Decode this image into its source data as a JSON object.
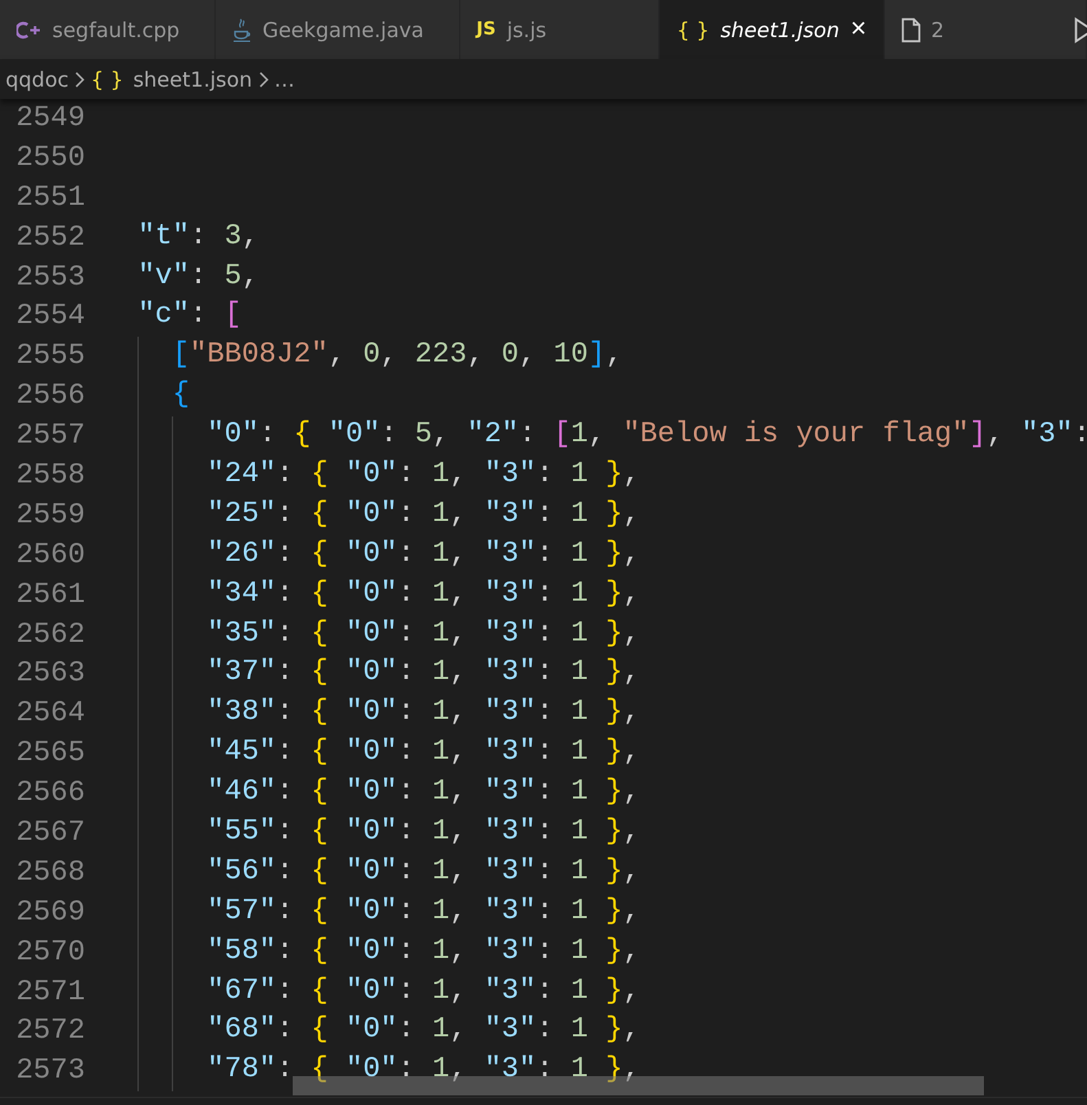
{
  "tabs": [
    {
      "kind": "cpp",
      "label": "segfault.cpp",
      "selected": false
    },
    {
      "kind": "java",
      "label": "Geekgame.java",
      "selected": false
    },
    {
      "kind": "js",
      "icon_text": "JS",
      "label": "js.js",
      "selected": false
    },
    {
      "kind": "json",
      "icon_text": "{ }",
      "label": "sheet1.json",
      "selected": true,
      "close": "×"
    },
    {
      "kind": "file",
      "label": "2",
      "selected": false
    }
  ],
  "breadcrumb": [
    {
      "text": "qqdoc"
    },
    {
      "icon_text": "{ }",
      "text": "sheet1.json"
    },
    {
      "text": "…"
    }
  ],
  "lines": [
    {
      "number": "2549"
    },
    {
      "number": "2550"
    },
    {
      "number": "2551"
    },
    {
      "number": "2552",
      "tokens": [
        {
          "kind": "key",
          "text": "  \"t\""
        },
        {
          "kind": "punct",
          "text": ": "
        },
        {
          "kind": "number",
          "text": "3"
        },
        {
          "kind": "punct",
          "text": ","
        }
      ]
    },
    {
      "number": "2553",
      "tokens": [
        {
          "kind": "key",
          "text": "  \"v\""
        },
        {
          "kind": "punct",
          "text": ": "
        },
        {
          "kind": "number",
          "text": "5"
        },
        {
          "kind": "punct",
          "text": ","
        }
      ]
    },
    {
      "number": "2554",
      "tokens": [
        {
          "kind": "key",
          "text": "  \"c\""
        },
        {
          "kind": "punct",
          "text": ": "
        },
        {
          "kind": "bracket-purple",
          "text": "["
        }
      ]
    },
    {
      "number": "2555",
      "tokens": [
        {
          "kind": "bracket-blue",
          "text": "    ["
        },
        {
          "kind": "string",
          "text": "\"BB08J2\""
        },
        {
          "kind": "punct",
          "text": ", "
        },
        {
          "kind": "number",
          "text": "0"
        },
        {
          "kind": "punct",
          "text": ", "
        },
        {
          "kind": "number",
          "text": "223"
        },
        {
          "kind": "punct",
          "text": ", "
        },
        {
          "kind": "number",
          "text": "0"
        },
        {
          "kind": "punct",
          "text": ", "
        },
        {
          "kind": "number",
          "text": "10"
        },
        {
          "kind": "bracket-blue",
          "text": "]"
        },
        {
          "kind": "punct",
          "text": ","
        }
      ]
    },
    {
      "number": "2556",
      "tokens": [
        {
          "kind": "bracket-blue",
          "text": "    {"
        }
      ]
    },
    {
      "number": "2557",
      "tokens": [
        {
          "kind": "key",
          "text": "      \"0\""
        },
        {
          "kind": "punct",
          "text": ": "
        },
        {
          "kind": "bracket-gold",
          "text": "{ "
        },
        {
          "kind": "key",
          "text": "\"0\""
        },
        {
          "kind": "punct",
          "text": ": "
        },
        {
          "kind": "number",
          "text": "5"
        },
        {
          "kind": "punct",
          "text": ", "
        },
        {
          "kind": "key",
          "text": "\"2\""
        },
        {
          "kind": "punct",
          "text": ": "
        },
        {
          "kind": "bracket-purple",
          "text": "["
        },
        {
          "kind": "number",
          "text": "1"
        },
        {
          "kind": "punct",
          "text": ", "
        },
        {
          "kind": "string",
          "text": "\"Below is your flag\""
        },
        {
          "kind": "bracket-purple",
          "text": "]"
        },
        {
          "kind": "punct",
          "text": ", "
        },
        {
          "kind": "key",
          "text": "\"3\""
        },
        {
          "kind": "punct",
          "text": ":"
        }
      ]
    },
    {
      "number": "2558",
      "tokens": [
        {
          "kind": "key",
          "text": "      \"24\""
        },
        {
          "kind": "punct",
          "text": ": "
        },
        {
          "kind": "bracket-gold",
          "text": "{ "
        },
        {
          "kind": "key",
          "text": "\"0\""
        },
        {
          "kind": "punct",
          "text": ": "
        },
        {
          "kind": "number",
          "text": "1"
        },
        {
          "kind": "punct",
          "text": ", "
        },
        {
          "kind": "key",
          "text": "\"3\""
        },
        {
          "kind": "punct",
          "text": ": "
        },
        {
          "kind": "number",
          "text": "1 "
        },
        {
          "kind": "bracket-gold",
          "text": "}"
        },
        {
          "kind": "punct",
          "text": ","
        }
      ]
    },
    {
      "number": "2559",
      "tokens": [
        {
          "kind": "key",
          "text": "      \"25\""
        },
        {
          "kind": "punct",
          "text": ": "
        },
        {
          "kind": "bracket-gold",
          "text": "{ "
        },
        {
          "kind": "key",
          "text": "\"0\""
        },
        {
          "kind": "punct",
          "text": ": "
        },
        {
          "kind": "number",
          "text": "1"
        },
        {
          "kind": "punct",
          "text": ", "
        },
        {
          "kind": "key",
          "text": "\"3\""
        },
        {
          "kind": "punct",
          "text": ": "
        },
        {
          "kind": "number",
          "text": "1 "
        },
        {
          "kind": "bracket-gold",
          "text": "}"
        },
        {
          "kind": "punct",
          "text": ","
        }
      ]
    },
    {
      "number": "2560",
      "tokens": [
        {
          "kind": "key",
          "text": "      \"26\""
        },
        {
          "kind": "punct",
          "text": ": "
        },
        {
          "kind": "bracket-gold",
          "text": "{ "
        },
        {
          "kind": "key",
          "text": "\"0\""
        },
        {
          "kind": "punct",
          "text": ": "
        },
        {
          "kind": "number",
          "text": "1"
        },
        {
          "kind": "punct",
          "text": ", "
        },
        {
          "kind": "key",
          "text": "\"3\""
        },
        {
          "kind": "punct",
          "text": ": "
        },
        {
          "kind": "number",
          "text": "1 "
        },
        {
          "kind": "bracket-gold",
          "text": "}"
        },
        {
          "kind": "punct",
          "text": ","
        }
      ]
    },
    {
      "number": "2561",
      "tokens": [
        {
          "kind": "key",
          "text": "      \"34\""
        },
        {
          "kind": "punct",
          "text": ": "
        },
        {
          "kind": "bracket-gold",
          "text": "{ "
        },
        {
          "kind": "key",
          "text": "\"0\""
        },
        {
          "kind": "punct",
          "text": ": "
        },
        {
          "kind": "number",
          "text": "1"
        },
        {
          "kind": "punct",
          "text": ", "
        },
        {
          "kind": "key",
          "text": "\"3\""
        },
        {
          "kind": "punct",
          "text": ": "
        },
        {
          "kind": "number",
          "text": "1 "
        },
        {
          "kind": "bracket-gold",
          "text": "}"
        },
        {
          "kind": "punct",
          "text": ","
        }
      ]
    },
    {
      "number": "2562",
      "tokens": [
        {
          "kind": "key",
          "text": "      \"35\""
        },
        {
          "kind": "punct",
          "text": ": "
        },
        {
          "kind": "bracket-gold",
          "text": "{ "
        },
        {
          "kind": "key",
          "text": "\"0\""
        },
        {
          "kind": "punct",
          "text": ": "
        },
        {
          "kind": "number",
          "text": "1"
        },
        {
          "kind": "punct",
          "text": ", "
        },
        {
          "kind": "key",
          "text": "\"3\""
        },
        {
          "kind": "punct",
          "text": ": "
        },
        {
          "kind": "number",
          "text": "1 "
        },
        {
          "kind": "bracket-gold",
          "text": "}"
        },
        {
          "kind": "punct",
          "text": ","
        }
      ]
    },
    {
      "number": "2563",
      "tokens": [
        {
          "kind": "key",
          "text": "      \"37\""
        },
        {
          "kind": "punct",
          "text": ": "
        },
        {
          "kind": "bracket-gold",
          "text": "{ "
        },
        {
          "kind": "key",
          "text": "\"0\""
        },
        {
          "kind": "punct",
          "text": ": "
        },
        {
          "kind": "number",
          "text": "1"
        },
        {
          "kind": "punct",
          "text": ", "
        },
        {
          "kind": "key",
          "text": "\"3\""
        },
        {
          "kind": "punct",
          "text": ": "
        },
        {
          "kind": "number",
          "text": "1 "
        },
        {
          "kind": "bracket-gold",
          "text": "}"
        },
        {
          "kind": "punct",
          "text": ","
        }
      ]
    },
    {
      "number": "2564",
      "tokens": [
        {
          "kind": "key",
          "text": "      \"38\""
        },
        {
          "kind": "punct",
          "text": ": "
        },
        {
          "kind": "bracket-gold",
          "text": "{ "
        },
        {
          "kind": "key",
          "text": "\"0\""
        },
        {
          "kind": "punct",
          "text": ": "
        },
        {
          "kind": "number",
          "text": "1"
        },
        {
          "kind": "punct",
          "text": ", "
        },
        {
          "kind": "key",
          "text": "\"3\""
        },
        {
          "kind": "punct",
          "text": ": "
        },
        {
          "kind": "number",
          "text": "1 "
        },
        {
          "kind": "bracket-gold",
          "text": "}"
        },
        {
          "kind": "punct",
          "text": ","
        }
      ]
    },
    {
      "number": "2565",
      "tokens": [
        {
          "kind": "key",
          "text": "      \"45\""
        },
        {
          "kind": "punct",
          "text": ": "
        },
        {
          "kind": "bracket-gold",
          "text": "{ "
        },
        {
          "kind": "key",
          "text": "\"0\""
        },
        {
          "kind": "punct",
          "text": ": "
        },
        {
          "kind": "number",
          "text": "1"
        },
        {
          "kind": "punct",
          "text": ", "
        },
        {
          "kind": "key",
          "text": "\"3\""
        },
        {
          "kind": "punct",
          "text": ": "
        },
        {
          "kind": "number",
          "text": "1 "
        },
        {
          "kind": "bracket-gold",
          "text": "}"
        },
        {
          "kind": "punct",
          "text": ","
        }
      ]
    },
    {
      "number": "2566",
      "tokens": [
        {
          "kind": "key",
          "text": "      \"46\""
        },
        {
          "kind": "punct",
          "text": ": "
        },
        {
          "kind": "bracket-gold",
          "text": "{ "
        },
        {
          "kind": "key",
          "text": "\"0\""
        },
        {
          "kind": "punct",
          "text": ": "
        },
        {
          "kind": "number",
          "text": "1"
        },
        {
          "kind": "punct",
          "text": ", "
        },
        {
          "kind": "key",
          "text": "\"3\""
        },
        {
          "kind": "punct",
          "text": ": "
        },
        {
          "kind": "number",
          "text": "1 "
        },
        {
          "kind": "bracket-gold",
          "text": "}"
        },
        {
          "kind": "punct",
          "text": ","
        }
      ]
    },
    {
      "number": "2567",
      "tokens": [
        {
          "kind": "key",
          "text": "      \"55\""
        },
        {
          "kind": "punct",
          "text": ": "
        },
        {
          "kind": "bracket-gold",
          "text": "{ "
        },
        {
          "kind": "key",
          "text": "\"0\""
        },
        {
          "kind": "punct",
          "text": ": "
        },
        {
          "kind": "number",
          "text": "1"
        },
        {
          "kind": "punct",
          "text": ", "
        },
        {
          "kind": "key",
          "text": "\"3\""
        },
        {
          "kind": "punct",
          "text": ": "
        },
        {
          "kind": "number",
          "text": "1 "
        },
        {
          "kind": "bracket-gold",
          "text": "}"
        },
        {
          "kind": "punct",
          "text": ","
        }
      ]
    },
    {
      "number": "2568",
      "tokens": [
        {
          "kind": "key",
          "text": "      \"56\""
        },
        {
          "kind": "punct",
          "text": ": "
        },
        {
          "kind": "bracket-gold",
          "text": "{ "
        },
        {
          "kind": "key",
          "text": "\"0\""
        },
        {
          "kind": "punct",
          "text": ": "
        },
        {
          "kind": "number",
          "text": "1"
        },
        {
          "kind": "punct",
          "text": ", "
        },
        {
          "kind": "key",
          "text": "\"3\""
        },
        {
          "kind": "punct",
          "text": ": "
        },
        {
          "kind": "number",
          "text": "1 "
        },
        {
          "kind": "bracket-gold",
          "text": "}"
        },
        {
          "kind": "punct",
          "text": ","
        }
      ]
    },
    {
      "number": "2569",
      "tokens": [
        {
          "kind": "key",
          "text": "      \"57\""
        },
        {
          "kind": "punct",
          "text": ": "
        },
        {
          "kind": "bracket-gold",
          "text": "{ "
        },
        {
          "kind": "key",
          "text": "\"0\""
        },
        {
          "kind": "punct",
          "text": ": "
        },
        {
          "kind": "number",
          "text": "1"
        },
        {
          "kind": "punct",
          "text": ", "
        },
        {
          "kind": "key",
          "text": "\"3\""
        },
        {
          "kind": "punct",
          "text": ": "
        },
        {
          "kind": "number",
          "text": "1 "
        },
        {
          "kind": "bracket-gold",
          "text": "}"
        },
        {
          "kind": "punct",
          "text": ","
        }
      ]
    },
    {
      "number": "2570",
      "tokens": [
        {
          "kind": "key",
          "text": "      \"58\""
        },
        {
          "kind": "punct",
          "text": ": "
        },
        {
          "kind": "bracket-gold",
          "text": "{ "
        },
        {
          "kind": "key",
          "text": "\"0\""
        },
        {
          "kind": "punct",
          "text": ": "
        },
        {
          "kind": "number",
          "text": "1"
        },
        {
          "kind": "punct",
          "text": ", "
        },
        {
          "kind": "key",
          "text": "\"3\""
        },
        {
          "kind": "punct",
          "text": ": "
        },
        {
          "kind": "number",
          "text": "1 "
        },
        {
          "kind": "bracket-gold",
          "text": "}"
        },
        {
          "kind": "punct",
          "text": ","
        }
      ]
    },
    {
      "number": "2571",
      "tokens": [
        {
          "kind": "key",
          "text": "      \"67\""
        },
        {
          "kind": "punct",
          "text": ": "
        },
        {
          "kind": "bracket-gold",
          "text": "{ "
        },
        {
          "kind": "key",
          "text": "\"0\""
        },
        {
          "kind": "punct",
          "text": ": "
        },
        {
          "kind": "number",
          "text": "1"
        },
        {
          "kind": "punct",
          "text": ", "
        },
        {
          "kind": "key",
          "text": "\"3\""
        },
        {
          "kind": "punct",
          "text": ": "
        },
        {
          "kind": "number",
          "text": "1 "
        },
        {
          "kind": "bracket-gold",
          "text": "}"
        },
        {
          "kind": "punct",
          "text": ","
        }
      ]
    },
    {
      "number": "2572",
      "tokens": [
        {
          "kind": "key",
          "text": "      \"68\""
        },
        {
          "kind": "punct",
          "text": ": "
        },
        {
          "kind": "bracket-gold",
          "text": "{ "
        },
        {
          "kind": "key",
          "text": "\"0\""
        },
        {
          "kind": "punct",
          "text": ": "
        },
        {
          "kind": "number",
          "text": "1"
        },
        {
          "kind": "punct",
          "text": ", "
        },
        {
          "kind": "key",
          "text": "\"3\""
        },
        {
          "kind": "punct",
          "text": ": "
        },
        {
          "kind": "number",
          "text": "1 "
        },
        {
          "kind": "bracket-gold",
          "text": "}"
        },
        {
          "kind": "punct",
          "text": ","
        }
      ]
    },
    {
      "number": "2573",
      "tokens": [
        {
          "kind": "key",
          "text": "      \"78\""
        },
        {
          "kind": "punct",
          "text": ": "
        },
        {
          "kind": "bracket-gold",
          "text": "{ "
        },
        {
          "kind": "key",
          "text": "\"0\""
        },
        {
          "kind": "punct",
          "text": ": "
        },
        {
          "kind": "number",
          "text": "1"
        },
        {
          "kind": "punct",
          "text": ", "
        },
        {
          "kind": "key",
          "text": "\"3\""
        },
        {
          "kind": "punct",
          "text": ": "
        },
        {
          "kind": "number",
          "text": "1 "
        },
        {
          "kind": "bracket-gold",
          "text": "}"
        },
        {
          "kind": "punct",
          "text": ","
        }
      ]
    }
  ]
}
